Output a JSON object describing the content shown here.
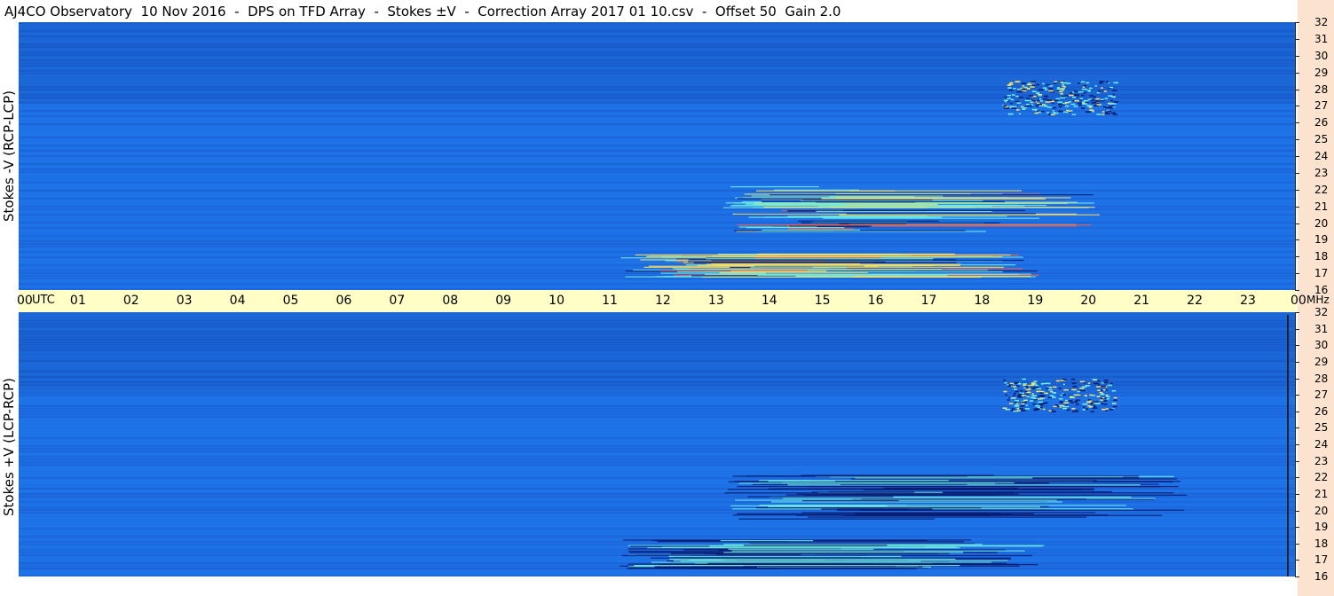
{
  "header": {
    "title": "AJ4CO Observatory  10 Nov 2016  -  DPS on TFD Array  -  Stokes ±V  -  Correction Array 2017 01 10.csv  -  Offset 50  Gain 2.0"
  },
  "colors": {
    "background_blue": "#1d6fe6",
    "time_axis_bg": "#fffec6",
    "frequency_axis_bg": "#fbe3cf"
  },
  "chart_data": [
    {
      "type": "heatmap",
      "ylabel": "Stokes -V (RCP-LCP)",
      "x_unit_label": "UTC",
      "y_unit_label": "MHz",
      "x_ticks": [
        "00",
        "01",
        "02",
        "03",
        "04",
        "05",
        "06",
        "07",
        "08",
        "09",
        "10",
        "11",
        "12",
        "13",
        "14",
        "15",
        "16",
        "17",
        "18",
        "19",
        "20",
        "21",
        "22",
        "23",
        "00"
      ],
      "xlim": [
        0,
        24
      ],
      "y_ticks": [
        "32",
        "31",
        "30",
        "29",
        "28",
        "27",
        "26",
        "25",
        "24",
        "23",
        "22",
        "21",
        "20",
        "19",
        "18",
        "17",
        "16"
      ],
      "ylim": [
        16,
        32
      ],
      "colormap": [
        "#0a1a6e",
        "#1d6fe6",
        "#2fa6f2",
        "#6ff0e0",
        "#ffe15a",
        "#ff5a3a"
      ],
      "features": [
        {
          "hours": [
            18.5,
            20.6
          ],
          "mhz": [
            26.5,
            28.5
          ],
          "description": "speckled emission cluster"
        },
        {
          "hours": [
            11.3,
            19.2
          ],
          "mhz": [
            16.8,
            18.2
          ],
          "description": "bright emission bands"
        },
        {
          "hours": [
            13.2,
            20.4
          ],
          "mhz": [
            19.5,
            22.2
          ],
          "description": "emission streaks"
        }
      ]
    },
    {
      "type": "heatmap",
      "ylabel": "Stokes +V (LCP-RCP)",
      "x_unit_label": "UTC",
      "y_unit_label": "MHz",
      "x_ticks": [
        "00",
        "01",
        "02",
        "03",
        "04",
        "05",
        "06",
        "07",
        "08",
        "09",
        "10",
        "11",
        "12",
        "13",
        "14",
        "15",
        "16",
        "17",
        "18",
        "19",
        "20",
        "21",
        "22",
        "23",
        "00"
      ],
      "xlim": [
        0,
        24
      ],
      "y_ticks": [
        "32",
        "31",
        "30",
        "29",
        "28",
        "27",
        "26",
        "25",
        "24",
        "23",
        "22",
        "21",
        "20",
        "19",
        "18",
        "17",
        "16"
      ],
      "ylim": [
        16,
        32
      ],
      "colormap": [
        "#0a1a6e",
        "#1d6fe6",
        "#2fa6f2",
        "#6ff0e0",
        "#ffe15a",
        "#ff5a3a"
      ],
      "features": [
        {
          "hours": [
            18.5,
            20.6
          ],
          "mhz": [
            26.0,
            28.0
          ],
          "description": "speckled emission cluster"
        },
        {
          "hours": [
            11.3,
            19.5
          ],
          "mhz": [
            16.5,
            18.3
          ],
          "description": "dark absorption bands"
        },
        {
          "hours": [
            13.2,
            22.0
          ],
          "mhz": [
            19.5,
            22.2
          ],
          "description": "dark streaks"
        }
      ]
    }
  ]
}
